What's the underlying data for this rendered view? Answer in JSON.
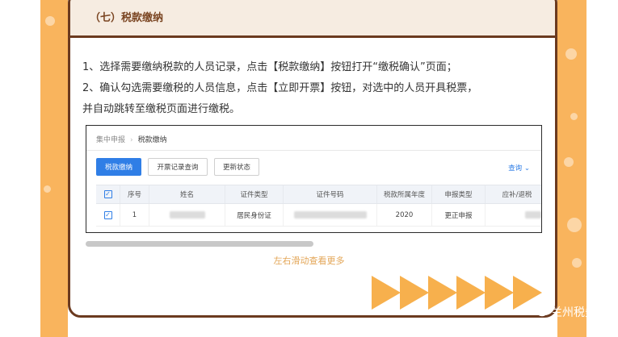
{
  "section": {
    "title": "（七）税款缴纳"
  },
  "instructions": {
    "line1": "1、选择需要缴纳税款的人员记录，点击【税款缴纳】按钮打开“缴税确认”页面；",
    "line2": "2、确认勾选需要缴税的人员信息，点击【立即开票】按钮，对选中的人员开具税票，",
    "line3": "并自动跳转至缴税页面进行缴税。"
  },
  "screenshot": {
    "breadcrumb": [
      "集中申报",
      "税款缴纳"
    ],
    "buttons": {
      "pay": "税款缴纳",
      "invoice_query": "开票记录查询",
      "refresh": "更新状态"
    },
    "query_link": "查询",
    "table": {
      "headers": [
        "序号",
        "姓名",
        "证件类型",
        "证件号码",
        "税款所属年度",
        "申报类型",
        "应补/退税"
      ],
      "rows": [
        {
          "index": "1",
          "id_type": "居民身份证",
          "year": "2020",
          "declare_type": "更正申报"
        }
      ]
    }
  },
  "hint": "左右滑动查看更多",
  "watermark": "兰州税务",
  "colors": {
    "accent_orange": "#f9b45d",
    "brown": "#6b3a1f",
    "primary_blue": "#2f7ee6"
  },
  "icons": {
    "badge": "pointer-arrow-icon",
    "watermark": "wechat-icon"
  }
}
